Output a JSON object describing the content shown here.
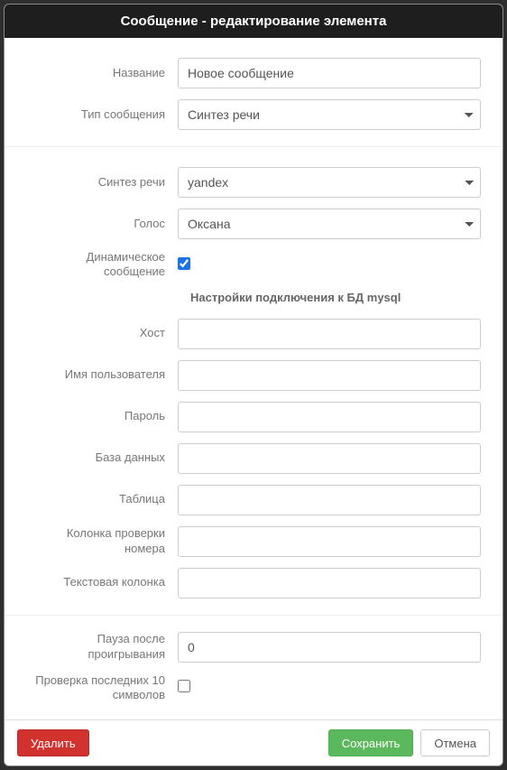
{
  "title": "Сообщение - редактирование элемента",
  "section1": {
    "name_label": "Название",
    "name_value": "Новое сообщение",
    "type_label": "Тип сообщения",
    "type_value": "Синтез речи"
  },
  "section2": {
    "tts_label": "Синтез речи",
    "tts_value": "yandex",
    "voice_label": "Голос",
    "voice_value": "Оксана",
    "dynamic_label": "Динамическое сообщение",
    "dynamic_checked": true,
    "db_heading": "Настройки подключения к БД mysql",
    "host_label": "Хост",
    "host_value": "",
    "user_label": "Имя пользователя",
    "user_value": "",
    "password_label": "Пароль",
    "password_value": "",
    "database_label": "База данных",
    "database_value": "",
    "table_label": "Таблица",
    "table_value": "",
    "check_col_label": "Колонка проверки номера",
    "check_col_value": "",
    "text_col_label": "Текстовая колонка",
    "text_col_value": ""
  },
  "section3": {
    "pause_label": "Пауза после проигрывания",
    "pause_value": "0",
    "check10_label": "Проверка последних 10 символов",
    "check10_checked": false
  },
  "footer": {
    "delete": "Удалить",
    "save": "Сохранить",
    "cancel": "Отмена"
  }
}
